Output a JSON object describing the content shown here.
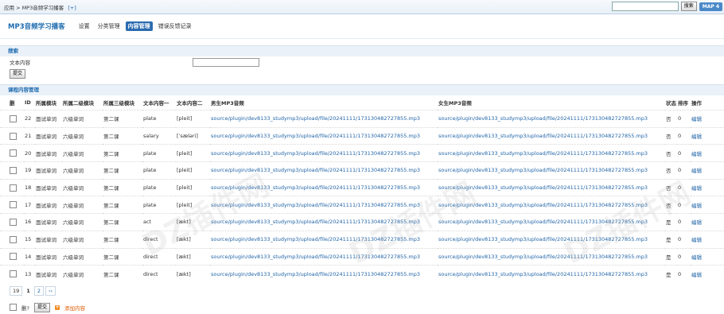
{
  "topbar": {
    "breadcrumb": "应用 > MP3音频学习播客",
    "plus": "[+]",
    "search_button": "搜索",
    "map_button": "MAP 4"
  },
  "header": {
    "title": "MP3音频学习播客",
    "tabs": [
      "设置",
      "分类管理",
      "内容管理",
      "错误反馈记录"
    ],
    "active_tab": 2
  },
  "search": {
    "section_title": "搜索",
    "field_label": "文本内容",
    "field_value": "",
    "submit_label": "提交"
  },
  "table": {
    "section_title": "课程内容管理",
    "headers": [
      "删",
      "ID",
      "所属模块",
      "所属二级模块",
      "所属三级模块",
      "文本内容一",
      "文本内容二",
      "男生MP3音频",
      "女生MP3音频",
      "状态",
      "排序",
      "操作"
    ],
    "rows": [
      {
        "id": "22",
        "m1": "面试单词",
        "m2": "六级单词",
        "m3": "第二课",
        "t1": "plate",
        "t2": "[pleit]",
        "male": "source/plugin/dev8133_studymp3/upload/file/20241111/173130482727855.mp3",
        "female": "source/plugin/dev8133_studymp3/upload/file/20241111/173130482727855.mp3",
        "status": "否",
        "sort": "0",
        "op": "编辑"
      },
      {
        "id": "21",
        "m1": "面试单词",
        "m2": "六级单词",
        "m3": "第二课",
        "t1": "salary",
        "t2": "[ˈsæləri]",
        "male": "source/plugin/dev8133_studymp3/upload/file/20241111/173130482727855.mp3",
        "female": "source/plugin/dev8133_studymp3/upload/file/20241111/173130482727855.mp3",
        "status": "否",
        "sort": "0",
        "op": "编辑"
      },
      {
        "id": "20",
        "m1": "面试单词",
        "m2": "六级单词",
        "m3": "第二课",
        "t1": "plate",
        "t2": "[pleit]",
        "male": "source/plugin/dev8133_studymp3/upload/file/20241111/173130482727855.mp3",
        "female": "source/plugin/dev8133_studymp3/upload/file/20241111/173130482727855.mp3",
        "status": "否",
        "sort": "0",
        "op": "编辑"
      },
      {
        "id": "19",
        "m1": "面试单词",
        "m2": "六级单词",
        "m3": "第二课",
        "t1": "plate",
        "t2": "[pleit]",
        "male": "source/plugin/dev8133_studymp3/upload/file/20241111/173130482727855.mp3",
        "female": "source/plugin/dev8133_studymp3/upload/file/20241111/173130482727855.mp3",
        "status": "否",
        "sort": "0",
        "op": "编辑"
      },
      {
        "id": "18",
        "m1": "面试单词",
        "m2": "六级单词",
        "m3": "第二课",
        "t1": "plate",
        "t2": "[pleit]",
        "male": "source/plugin/dev8133_studymp3/upload/file/20241111/173130482727855.mp3",
        "female": "source/plugin/dev8133_studymp3/upload/file/20241111/173130482727855.mp3",
        "status": "否",
        "sort": "0",
        "op": "编辑"
      },
      {
        "id": "17",
        "m1": "面试单词",
        "m2": "六级单词",
        "m3": "第二课",
        "t1": "plate",
        "t2": "[pleit]",
        "male": "source/plugin/dev8133_studymp3/upload/file/20241111/173130482727855.mp3",
        "female": "source/plugin/dev8133_studymp3/upload/file/20241111/173130482727855.mp3",
        "status": "否",
        "sort": "0",
        "op": "编辑"
      },
      {
        "id": "16",
        "m1": "面试单词",
        "m2": "六级单词",
        "m3": "第二课",
        "t1": "act",
        "t2": "[ækt]",
        "male": "source/plugin/dev8133_studymp3/upload/file/20241111/173130482727855.mp3",
        "female": "source/plugin/dev8133_studymp3/upload/file/20241111/173130482727855.mp3",
        "status": "是",
        "sort": "0",
        "op": "编辑"
      },
      {
        "id": "15",
        "m1": "面试单词",
        "m2": "六级单词",
        "m3": "第二课",
        "t1": "direct",
        "t2": "[ækt]",
        "male": "source/plugin/dev8133_studymp3/upload/file/20241111/173130482727855.mp3",
        "female": "source/plugin/dev8133_studymp3/upload/file/20241111/173130482727855.mp3",
        "status": "是",
        "sort": "0",
        "op": "编辑"
      },
      {
        "id": "14",
        "m1": "面试单词",
        "m2": "六级单词",
        "m3": "第二课",
        "t1": "direct",
        "t2": "[ækt]",
        "male": "source/plugin/dev8133_studymp3/upload/file/20241111/173130482727855.mp3",
        "female": "source/plugin/dev8133_studymp3/upload/file/20241111/173130482727855.mp3",
        "status": "是",
        "sort": "0",
        "op": "编辑"
      },
      {
        "id": "13",
        "m1": "面试单词",
        "m2": "六级单词",
        "m3": "第二课",
        "t1": "direct",
        "t2": "[ækt]",
        "male": "source/plugin/dev8133_studymp3/upload/file/20241111/173130482727855.mp3",
        "female": "source/plugin/dev8133_studymp3/upload/file/20241111/173130482727855.mp3",
        "status": "是",
        "sort": "0",
        "op": "编辑"
      }
    ]
  },
  "pager": {
    "total": "19",
    "current": "1",
    "next_page": "2",
    "next": "››"
  },
  "footer": {
    "delete_label": "删?",
    "submit_label": "提交",
    "add_label": "添加内容"
  }
}
